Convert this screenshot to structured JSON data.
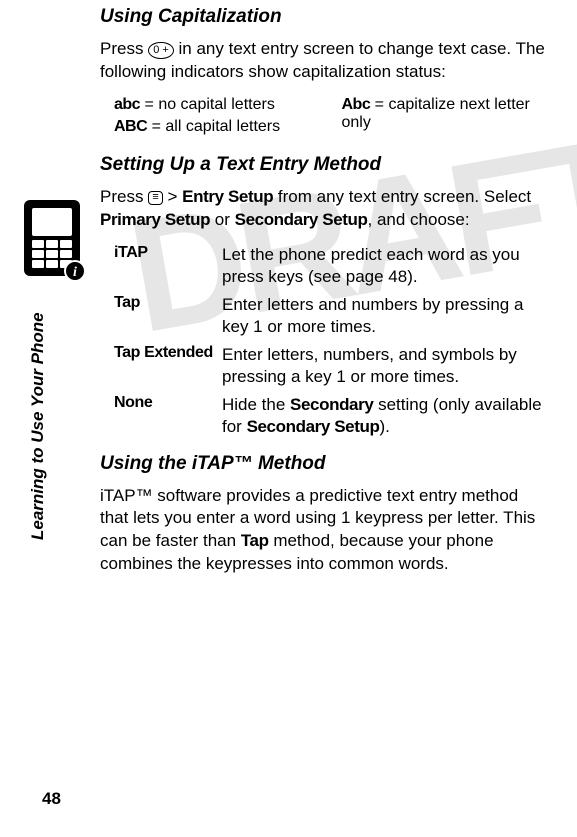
{
  "page_number": "48",
  "side_label": "Learning to Use Your Phone",
  "draft_text": "DRAFT",
  "info_badge": "i",
  "sections": {
    "cap": {
      "heading": "Using Capitalization",
      "body": "Press [0] in any text entry screen to change text case. The following indicators show capitalization status:",
      "left": [
        {
          "sym": "abc",
          "desc": " = no capital letters"
        },
        {
          "sym": "ABC",
          "desc": " = all capital letters"
        }
      ],
      "right": [
        {
          "sym": "Abc",
          "desc": " = capitalize next letter only"
        }
      ]
    },
    "setup": {
      "heading": "Setting Up a Text Entry Method",
      "body_pre": "Press ",
      "menu_key": "≡",
      "body_mid1": " > ",
      "entry_setup": "Entry Setup",
      "body_mid2": " from any text entry screen. Select ",
      "primary": "Primary Setup",
      "or": " or ",
      "secondary": "Secondary Setup",
      "body_end": ", and choose:",
      "rows": [
        {
          "term": "iTAP",
          "desc": "Let the phone predict each word as you press keys (see page 48)."
        },
        {
          "term": "Tap",
          "desc": "Enter letters and numbers by pressing a key 1 or more times."
        },
        {
          "term": "Tap Extended",
          "desc": "Enter letters, numbers, and symbols by pressing a key 1 or more times."
        },
        {
          "term": "None",
          "desc_pre": "Hide the ",
          "desc_mid1": "Secondary",
          "desc_mid2": " setting (only available for ",
          "desc_mid3": "Secondary Setup",
          "desc_end": ")."
        }
      ]
    },
    "itap": {
      "heading": "Using the iTAP™ Method",
      "body_pre": "iTAP™ software provides a predictive text entry method that lets you enter a word using 1 keypress per letter. This can be faster than ",
      "tap": "Tap",
      "body_end": " method, because your phone combines the keypresses into common words."
    }
  }
}
